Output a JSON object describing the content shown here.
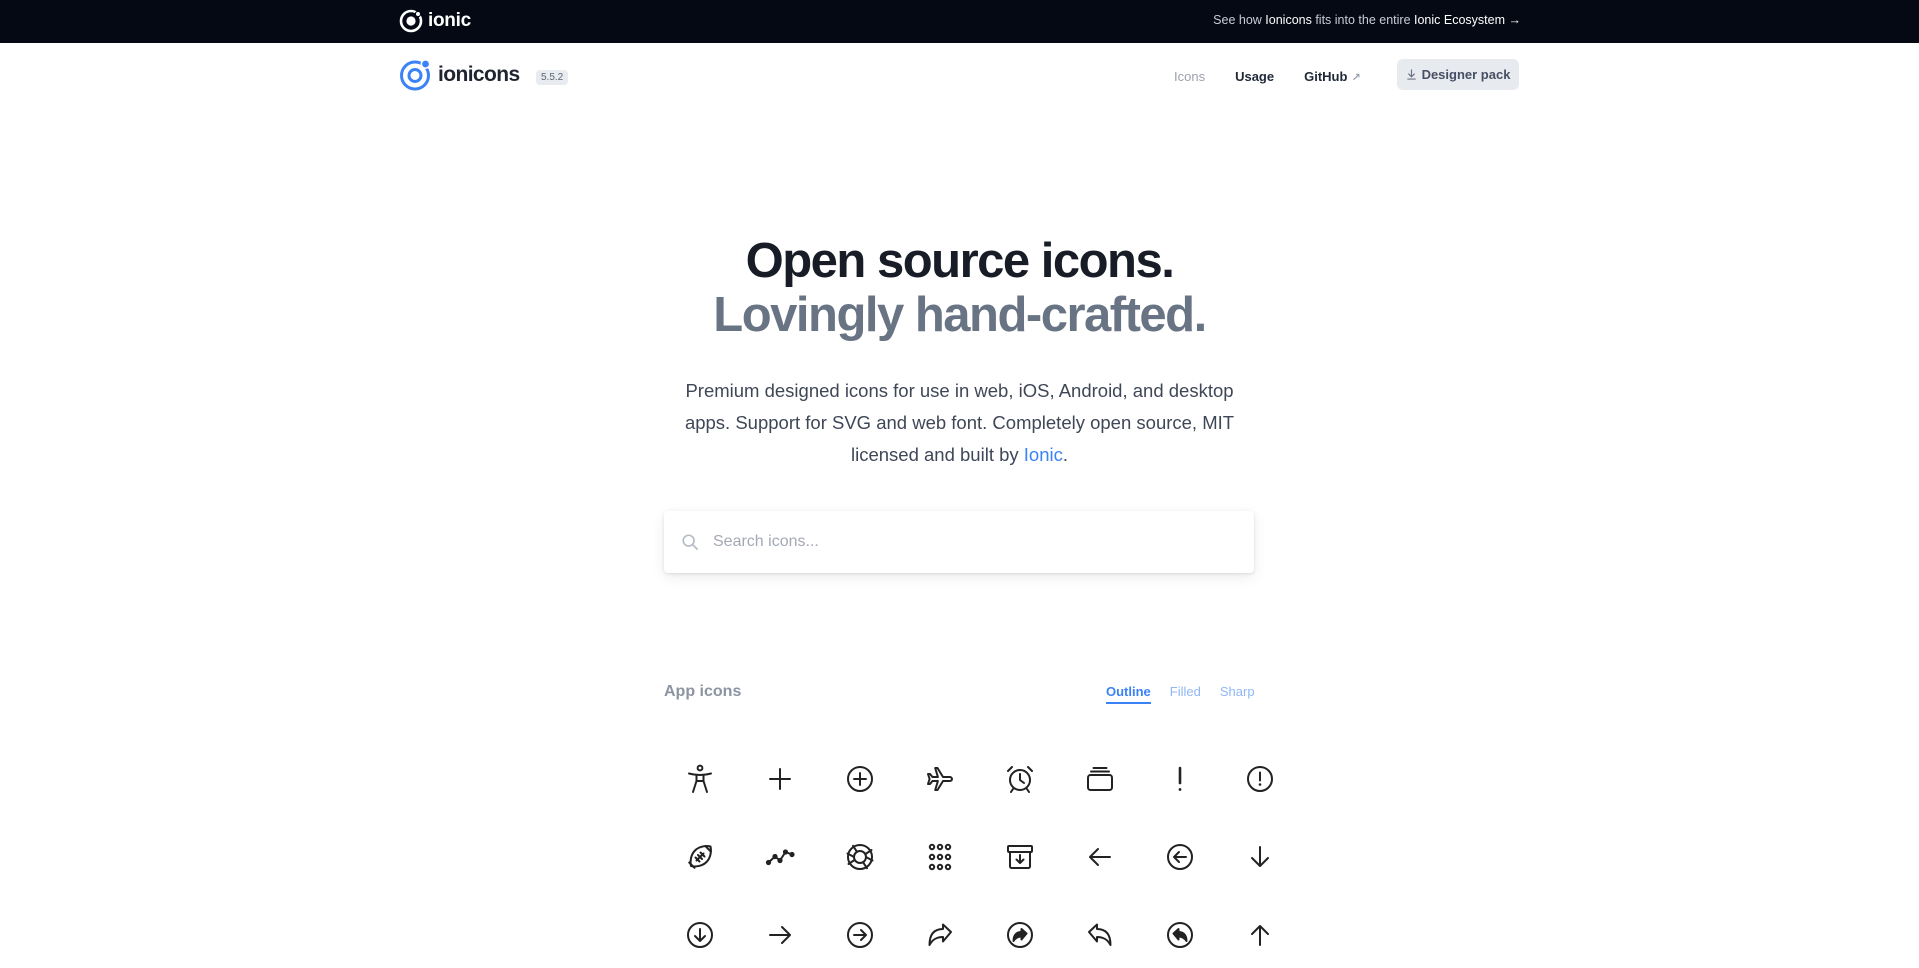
{
  "topbar": {
    "brand": "ionic",
    "eco_prefix": "See how ",
    "eco_product": "Ionicons",
    "eco_middle": " fits into the entire ",
    "eco_link": "Ionic Ecosystem",
    "eco_arrow": "→"
  },
  "nav": {
    "logo_text": "ionicons",
    "version": "5.5.2",
    "links": {
      "icons": "Icons",
      "usage": "Usage",
      "github": "GitHub",
      "github_ext": "↗"
    },
    "designer_label": "Designer pack"
  },
  "hero": {
    "line1": "Open source icons.",
    "line2": "Lovingly hand-crafted.",
    "sub_prefix": "Premium designed icons for use in web, iOS, Android, and desktop apps. Support for SVG and web font. Completely open source, MIT licensed and built by ",
    "sub_link": "Ionic",
    "sub_suffix": "."
  },
  "search": {
    "placeholder": "Search icons..."
  },
  "section": {
    "title": "App icons",
    "variants": [
      "Outline",
      "Filled",
      "Sharp"
    ],
    "active_variant": "Outline"
  },
  "icons": [
    "accessibility-icon",
    "add-icon",
    "add-circle-icon",
    "airplane-icon",
    "alarm-icon",
    "albums-icon",
    "alert-icon",
    "alert-circle-icon",
    "american-football-icon",
    "analytics-icon",
    "aperture-icon",
    "apps-icon",
    "archive-icon",
    "arrow-back-icon",
    "arrow-back-circle-icon",
    "arrow-down-icon",
    "arrow-down-circle-icon",
    "arrow-forward-icon",
    "arrow-forward-circle-icon",
    "arrow-redo-icon",
    "arrow-redo-circle-icon",
    "arrow-undo-icon",
    "arrow-undo-circle-icon",
    "arrow-up-icon"
  ],
  "colors": {
    "topbar_bg": "#040914",
    "accent": "#3b82f6",
    "heading_dark": "#171c26",
    "heading_gray": "#687384"
  }
}
